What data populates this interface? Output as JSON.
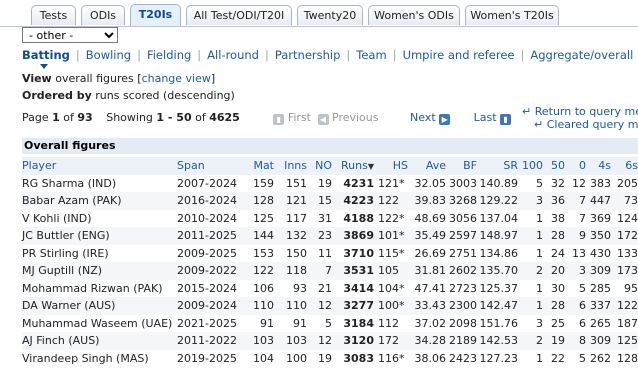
{
  "tabs": [
    {
      "label": "Tests",
      "active": false
    },
    {
      "label": "ODIs",
      "active": false
    },
    {
      "label": "T20Is",
      "active": true
    },
    {
      "label": "All Test/ODI/T20I",
      "active": false
    },
    {
      "label": "Twenty20",
      "active": false
    },
    {
      "label": "Women's ODIs",
      "active": false
    },
    {
      "label": "Women's T20Is",
      "active": false
    }
  ],
  "filter_select": {
    "value": "- other -"
  },
  "subnav": [
    "Batting",
    "Bowling",
    "Fielding",
    "All-round",
    "Partnership",
    "Team",
    "Umpire and referee",
    "Aggregate/overall"
  ],
  "view": {
    "prefix": "View",
    "text": "overall figures",
    "bracket_open": "[",
    "link": "change view",
    "bracket_close": "]"
  },
  "ordered": {
    "prefix": "Ordered by",
    "text": "runs scored (descending)"
  },
  "pager": {
    "page_label": "Page",
    "page": "1",
    "of": "of",
    "pages": "93",
    "showing_label": "Showing",
    "range": "1 - 50",
    "of2": "of",
    "total": "4625",
    "first": "First",
    "previous": "Previous",
    "next": "Next",
    "last": "Last"
  },
  "right_links": {
    "return": "Return to query menu",
    "cleared": "Cleared query menu"
  },
  "section_title": "Overall figures",
  "columns": [
    "Player",
    "Span",
    "Mat",
    "Inns",
    "NO",
    "Runs",
    "HS",
    "Ave",
    "BF",
    "SR",
    "100",
    "50",
    "0",
    "4s",
    "6s"
  ],
  "rows": [
    [
      "RG Sharma (IND)",
      "2007-2024",
      "159",
      "151",
      "19",
      "4231",
      "121*",
      "32.05",
      "3003",
      "140.89",
      "5",
      "32",
      "12",
      "383",
      "205"
    ],
    [
      "Babar Azam (PAK)",
      "2016-2024",
      "128",
      "121",
      "15",
      "4223",
      "122",
      "39.83",
      "3268",
      "129.22",
      "3",
      "36",
      "7",
      "447",
      "73"
    ],
    [
      "V Kohli (IND)",
      "2010-2024",
      "125",
      "117",
      "31",
      "4188",
      "122*",
      "48.69",
      "3056",
      "137.04",
      "1",
      "38",
      "7",
      "369",
      "124"
    ],
    [
      "JC Buttler (ENG)",
      "2011-2025",
      "144",
      "132",
      "23",
      "3869",
      "101*",
      "35.49",
      "2597",
      "148.97",
      "1",
      "28",
      "9",
      "350",
      "172"
    ],
    [
      "PR Stirling (IRE)",
      "2009-2025",
      "153",
      "150",
      "11",
      "3710",
      "115*",
      "26.69",
      "2751",
      "134.86",
      "1",
      "24",
      "13",
      "430",
      "133"
    ],
    [
      "MJ Guptill (NZ)",
      "2009-2022",
      "122",
      "118",
      "7",
      "3531",
      "105",
      "31.81",
      "2602",
      "135.70",
      "2",
      "20",
      "3",
      "309",
      "173"
    ],
    [
      "Mohammad Rizwan (PAK)",
      "2015-2024",
      "106",
      "93",
      "21",
      "3414",
      "104*",
      "47.41",
      "2723",
      "125.37",
      "1",
      "30",
      "5",
      "285",
      "95"
    ],
    [
      "DA Warner (AUS)",
      "2009-2024",
      "110",
      "110",
      "12",
      "3277",
      "100*",
      "33.43",
      "2300",
      "142.47",
      "1",
      "28",
      "6",
      "337",
      "122"
    ],
    [
      "Muhammad Waseem (UAE)",
      "2021-2025",
      "91",
      "91",
      "5",
      "3184",
      "112",
      "37.02",
      "2098",
      "151.76",
      "3",
      "25",
      "6",
      "265",
      "187"
    ],
    [
      "AJ Finch (AUS)",
      "2011-2022",
      "103",
      "103",
      "12",
      "3120",
      "172",
      "34.28",
      "2189",
      "142.53",
      "2",
      "19",
      "8",
      "309",
      "125"
    ],
    [
      "Virandeep Singh (MAS)",
      "2019-2025",
      "104",
      "100",
      "19",
      "3083",
      "116*",
      "38.06",
      "2423",
      "127.23",
      "1",
      "22",
      "5",
      "262",
      "128"
    ]
  ]
}
